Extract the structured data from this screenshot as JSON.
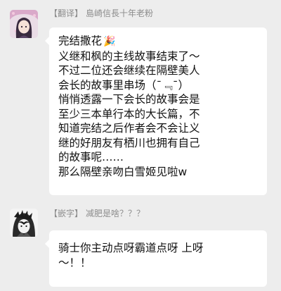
{
  "messages": [
    {
      "sender_tag": "【翻译】",
      "sender_name": "島崎信長十年老粉",
      "avatar_icon": "anime-character-avatar",
      "lines": [
        "完结撒花",
        "义继和枫的主线故事结束了～",
        "不过二位还会继续在隔壁美人",
        "会长的故事里串场（¯﹃¯）",
        "悄悄透露一下会长的故事会是",
        "至少三本单行本的大长篇，不",
        "知道完结之后作者会不会让义",
        "继的好朋友有栖川也拥有自己",
        "的故事呢……",
        "那么隔壁亲吻白雪姬见啦w"
      ],
      "emoji_icon": "party-popper-icon"
    },
    {
      "sender_tag": "【嵌字】",
      "sender_name": "减肥是啥？？？",
      "avatar_icon": "manga-character-avatar",
      "lines": [
        "骑士你主动点呀霸道点呀 上呀",
        "～！！"
      ]
    }
  ],
  "colors": {
    "background": "#ededed",
    "bubble": "#ffffff",
    "sender_text": "#8c8c8c",
    "message_text": "#111111"
  }
}
